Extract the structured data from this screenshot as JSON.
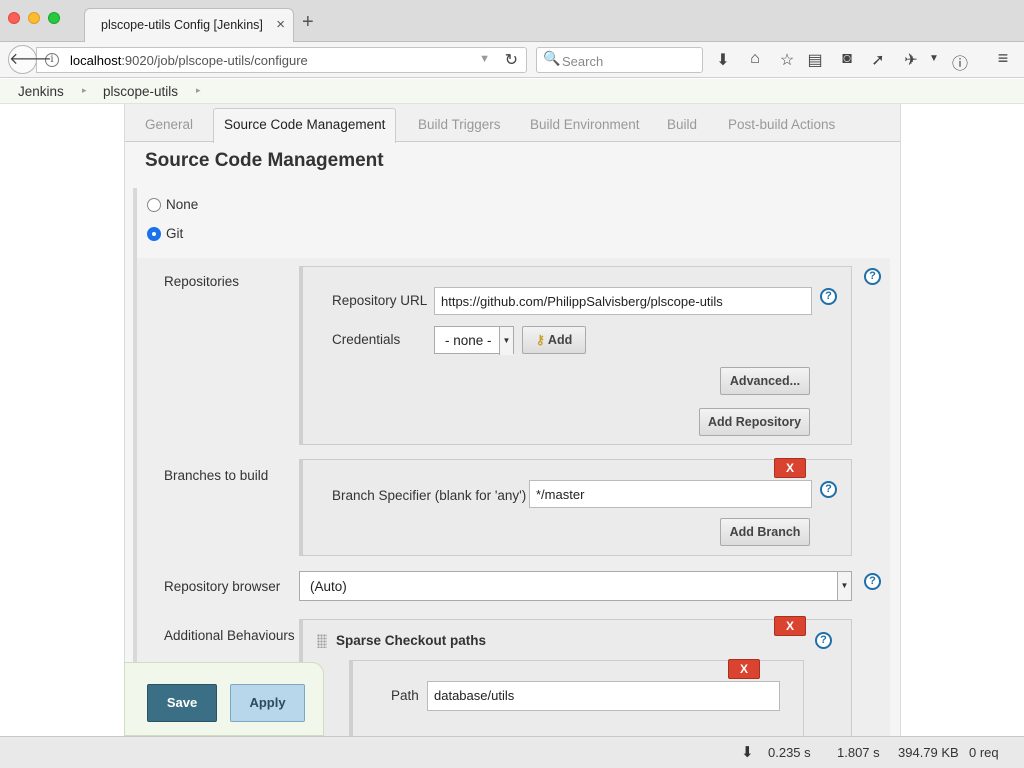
{
  "browser": {
    "tab_title": "plscope-utils Config [Jenkins]",
    "tab_close": "×",
    "new_tab": "+",
    "url_host": "localhost",
    "url_path": ":9020/job/plscope-utils/configure",
    "search_placeholder": "Search"
  },
  "breadcrumb": {
    "items": [
      "Jenkins",
      "plscope-utils"
    ],
    "separator": "▸"
  },
  "config_tabs": [
    "General",
    "Source Code Management",
    "Build Triggers",
    "Build Environment",
    "Build",
    "Post-build Actions"
  ],
  "section_title": "Source Code Management",
  "scm_options": {
    "none": "None",
    "git": "Git",
    "selected": "Git"
  },
  "repositories": {
    "label": "Repositories",
    "url_label": "Repository URL",
    "url_value": "https://github.com/PhilippSalvisberg/plscope-utils",
    "credentials_label": "Credentials",
    "credentials_value": "- none -",
    "add_label": "Add",
    "advanced_label": "Advanced...",
    "add_repository_label": "Add Repository"
  },
  "branches": {
    "label": "Branches to build",
    "specifier_label": "Branch Specifier (blank for 'any')",
    "specifier_value": "*/master",
    "add_branch_label": "Add Branch",
    "delete_label": "X"
  },
  "repository_browser": {
    "label": "Repository browser",
    "value": "(Auto)"
  },
  "additional_behaviours": {
    "label": "Additional Behaviours",
    "sparse_title": "Sparse Checkout paths",
    "delete_label": "X",
    "path_label": "Path",
    "path_value": "database/utils"
  },
  "help_glyph": "?",
  "buttons": {
    "save": "Save",
    "apply": "Apply"
  },
  "status_bar": {
    "time1": "0.235 s",
    "time2": "1.807 s",
    "size": "394.79 KB",
    "requests": "0 req"
  },
  "colors": {
    "save_button": "#3a6f86",
    "apply_button": "#b9d7ea",
    "delete_button": "#d9432f",
    "help_icon": "#1f6fa8"
  },
  "icons": [
    "back-icon",
    "info-icon",
    "reload-icon",
    "search-icon",
    "download-icon",
    "home-icon",
    "star-icon",
    "reading-list-icon",
    "pocket-icon",
    "send-icon",
    "extension-icon",
    "menu-icon",
    "help-icon",
    "key-icon",
    "drag-handle-icon"
  ]
}
